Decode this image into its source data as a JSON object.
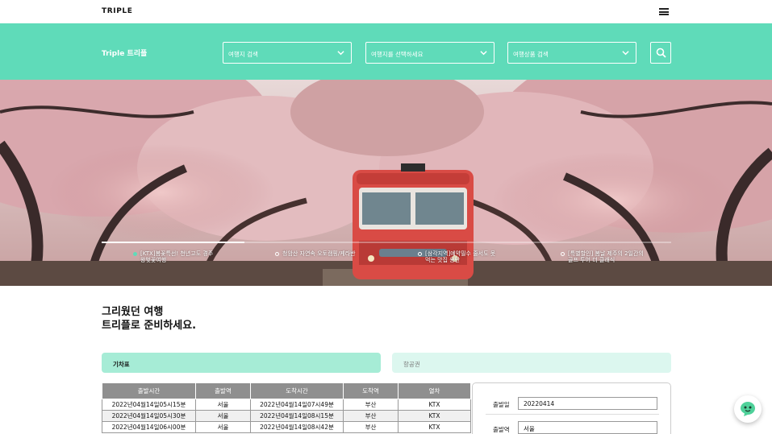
{
  "header": {
    "logo": "TRIPLE",
    "menu_icon": "hamburger-menu-icon"
  },
  "search_band": {
    "title": "Triple 트리플",
    "selects": [
      {
        "value": "여행지 검색"
      },
      {
        "value": "여행지를 선택하세요"
      },
      {
        "value": "여행상품 검색"
      }
    ],
    "search_icon": "search-icon",
    "accent_color": "#5fdbb9"
  },
  "hero": {
    "progress": 0.25,
    "slides": [
      {
        "line1": "[KTX]봄꽃특선! 천년고도 경주",
        "line2": "왕벚꽃여행",
        "active": true
      },
      {
        "line1": "청암산 자연속 오토캠핑/케라반",
        "line2": ""
      },
      {
        "line1": "[삼각지역]예약필수 줄서도 못",
        "line2": "먹는 맛집 용탄"
      },
      {
        "line1": "[특별할인] 봄날 제주의 2일간의",
        "line2": "골프 투어 더 클래식"
      }
    ]
  },
  "headline": {
    "line1": "그리웠던 여행",
    "line2": "트리플로 준비하세요."
  },
  "tabs": {
    "train": "기차표",
    "flight": "항공권"
  },
  "timetable": {
    "headers": [
      "출발시간",
      "출발역",
      "도착시간",
      "도착역",
      "열차"
    ],
    "rows": [
      [
        "2022년04월14일05시15분",
        "서울",
        "2022년04월14일07시49분",
        "부산",
        "KTX"
      ],
      [
        "2022년04월14일05시30분",
        "서울",
        "2022년04월14일08시15분",
        "부산",
        "KTX"
      ],
      [
        "2022년04월14일06시00분",
        "서울",
        "2022년04월14일08시42분",
        "부산",
        "KTX"
      ]
    ]
  },
  "form": {
    "date_label": "출발일",
    "date_value": "20220414",
    "station_label": "출발역",
    "station_value": "서울"
  },
  "chat": {
    "icon": "chatbot-face-icon"
  }
}
